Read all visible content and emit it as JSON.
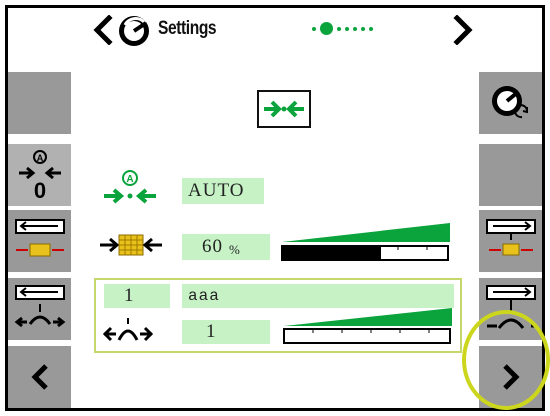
{
  "header": {
    "title": "Settings",
    "page_count": 7,
    "active_page_index": 1
  },
  "center": {
    "mode_value": "AUTO",
    "percent_value": "60",
    "percent_unit": "%",
    "percent_level": 0.6,
    "group_number": "1",
    "group_text": "aaa",
    "group_value": "1",
    "group_level": 0.0
  },
  "colors": {
    "accent_green": "#0aa33c",
    "field_bg": "#c6f2c6",
    "panel_gray": "#999999",
    "group_border": "#c4d86b",
    "highlight_circle": "#cbd61c",
    "grain_yellow": "#e8c21a"
  },
  "icons": {
    "header_left": "chevron-left-icon",
    "header_app": "gauge-icon",
    "header_right": "chevron-right-icon",
    "mode": "auto-converge-icon",
    "grain": "grain-converge-icon",
    "group": "rotor-spread-icon"
  }
}
